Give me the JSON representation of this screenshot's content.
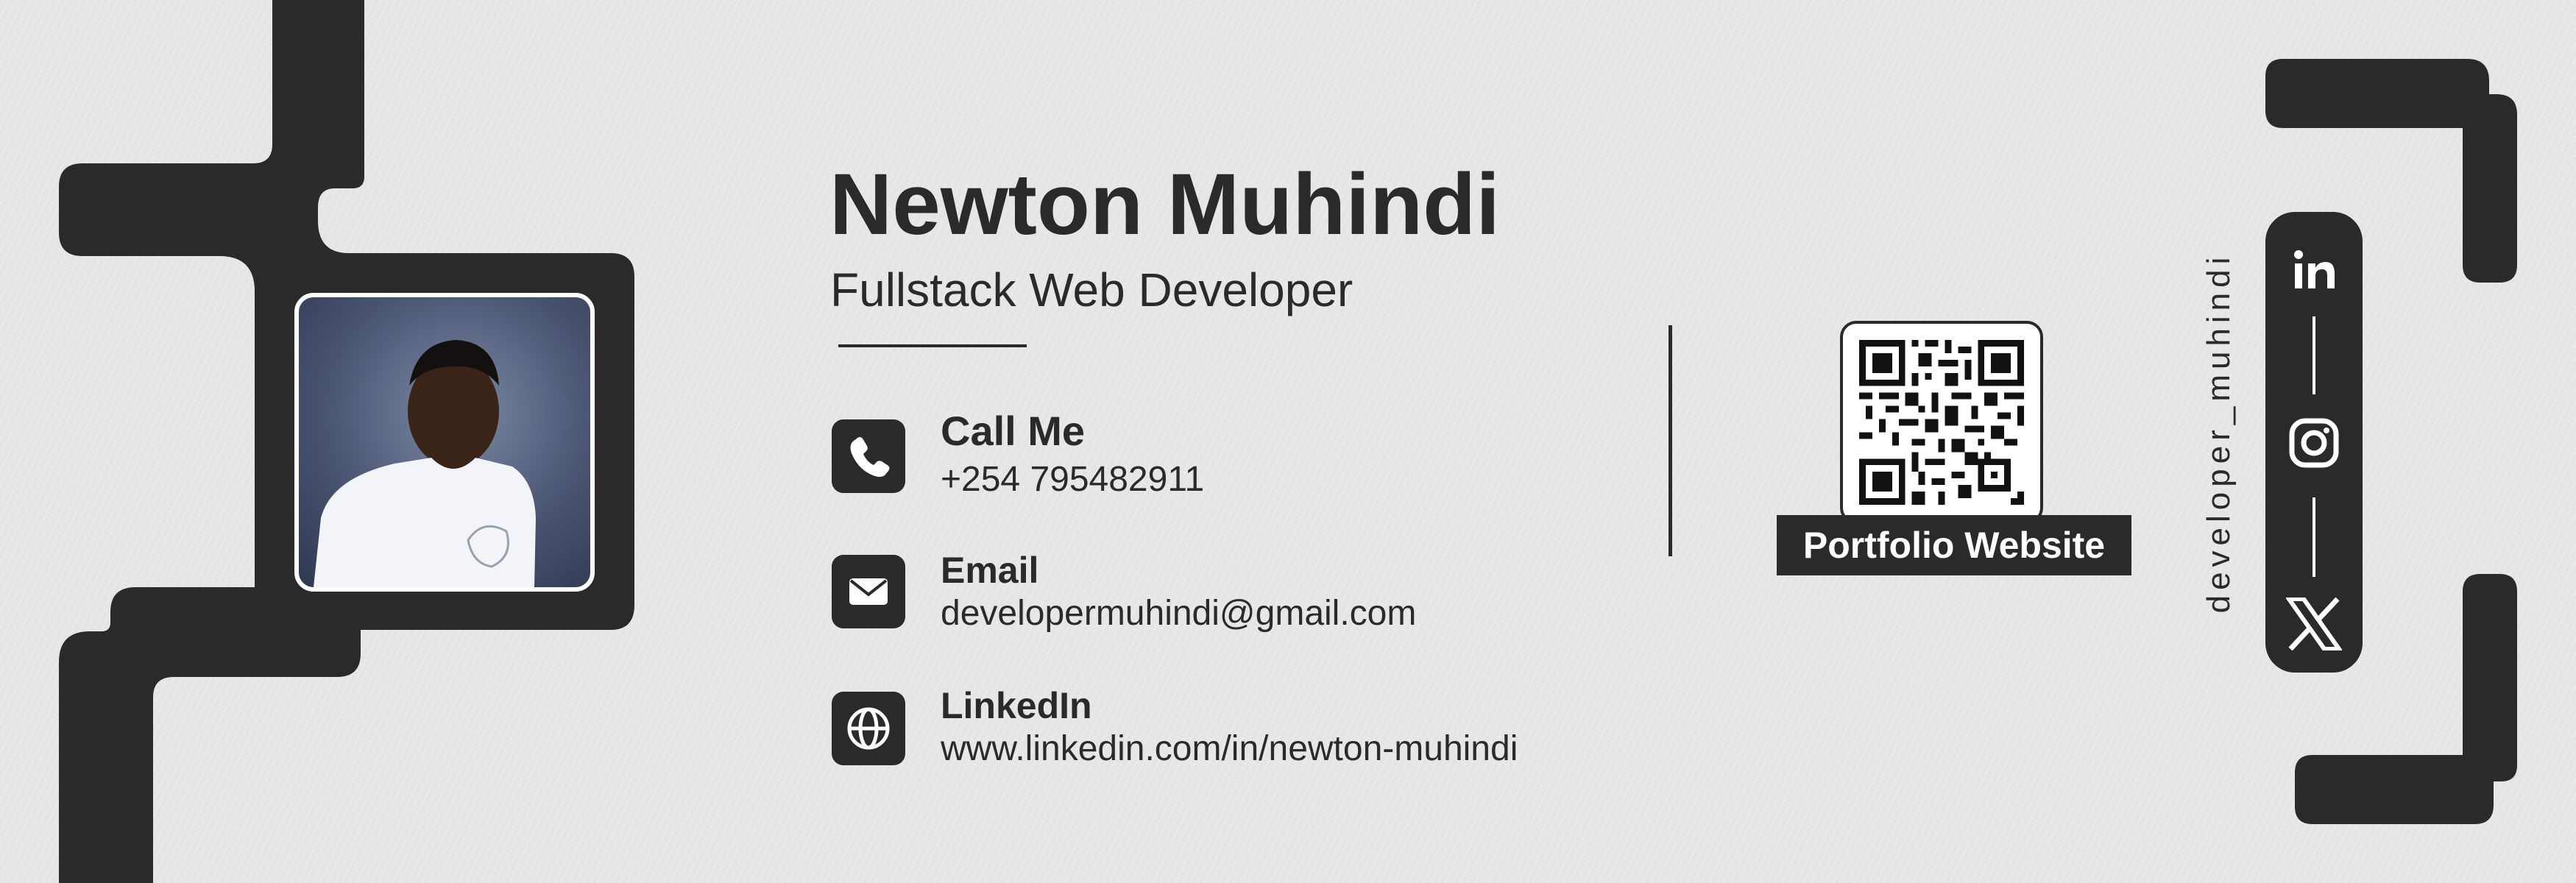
{
  "name": "Newton Muhindi",
  "title": "Fullstack Web Developer",
  "contacts": [
    {
      "icon": "phone-icon",
      "label": "Call Me",
      "value": "+254 795482911"
    },
    {
      "icon": "mail-icon",
      "label": "Email",
      "value": "developermuhindi@gmail.com"
    },
    {
      "icon": "globe-icon",
      "label": "LinkedIn",
      "value": "www.linkedin.com/in/newton-muhindi"
    }
  ],
  "qr": {
    "label": "Portfolio Website"
  },
  "social": {
    "handle": "developer_muhindi",
    "icons": [
      "linkedin-icon",
      "instagram-icon",
      "x-icon"
    ]
  },
  "colors": {
    "primary": "#2a2a2a",
    "background": "#e6e6e4",
    "accent_text": "#ffffff"
  }
}
